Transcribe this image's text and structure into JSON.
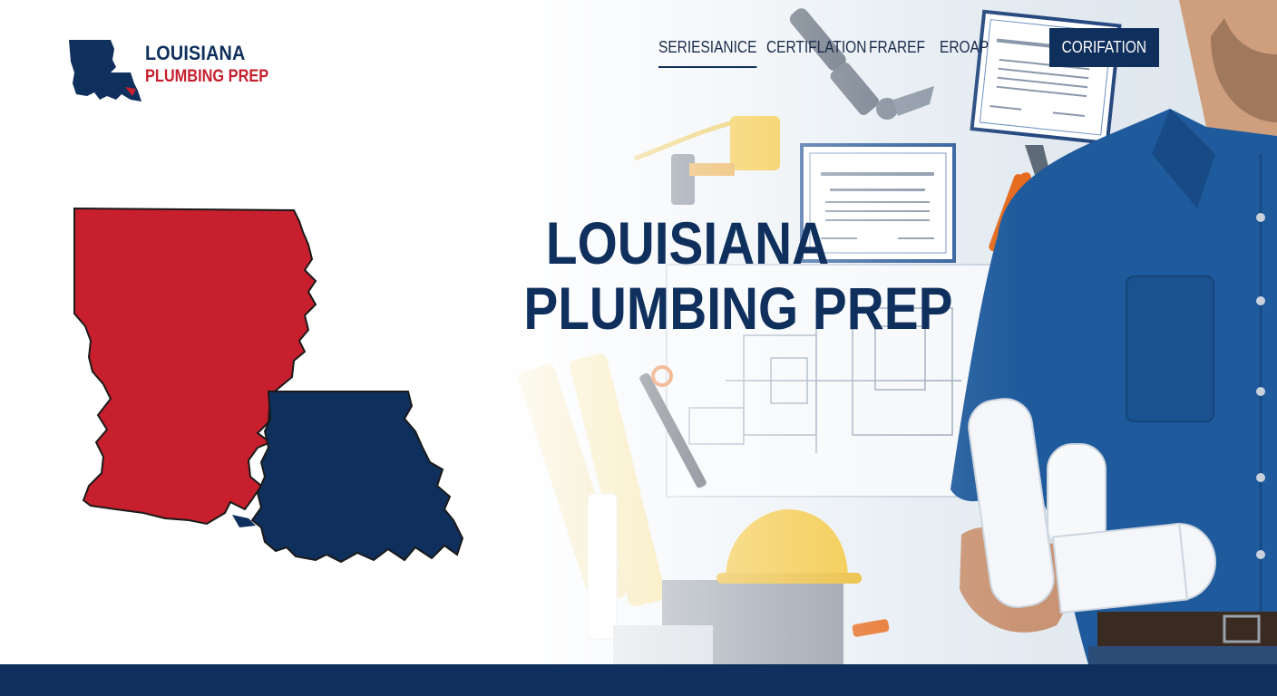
{
  "brand": {
    "line1": "LOUISIANA",
    "line2": "PLUMBING PREP",
    "logo_icon": "louisiana-state-icon"
  },
  "nav": {
    "items": [
      "SERIESIANICE",
      "CERTIFLATION",
      "FRAREF",
      "EROAP"
    ],
    "active": "SERIESIANICE",
    "cta_label": "CORIFATION"
  },
  "hero": {
    "headline_line1": "LOUISIANA",
    "headline_line2": "PLUMBING PREP",
    "map_icon": "louisiana-map-illustration",
    "photo_subject": "plumber-holding-blueprints",
    "tools": [
      "pipe-wrench-icon",
      "valve-icon",
      "hard-hat-icon",
      "pliers-icon",
      "certificate-icon",
      "blueprint-icon"
    ]
  },
  "colors": {
    "navy": "#0f2f5c",
    "red": "#c71f2d",
    "shirt_blue": "#1e5a9c",
    "hard_hat": "#f2c230"
  }
}
